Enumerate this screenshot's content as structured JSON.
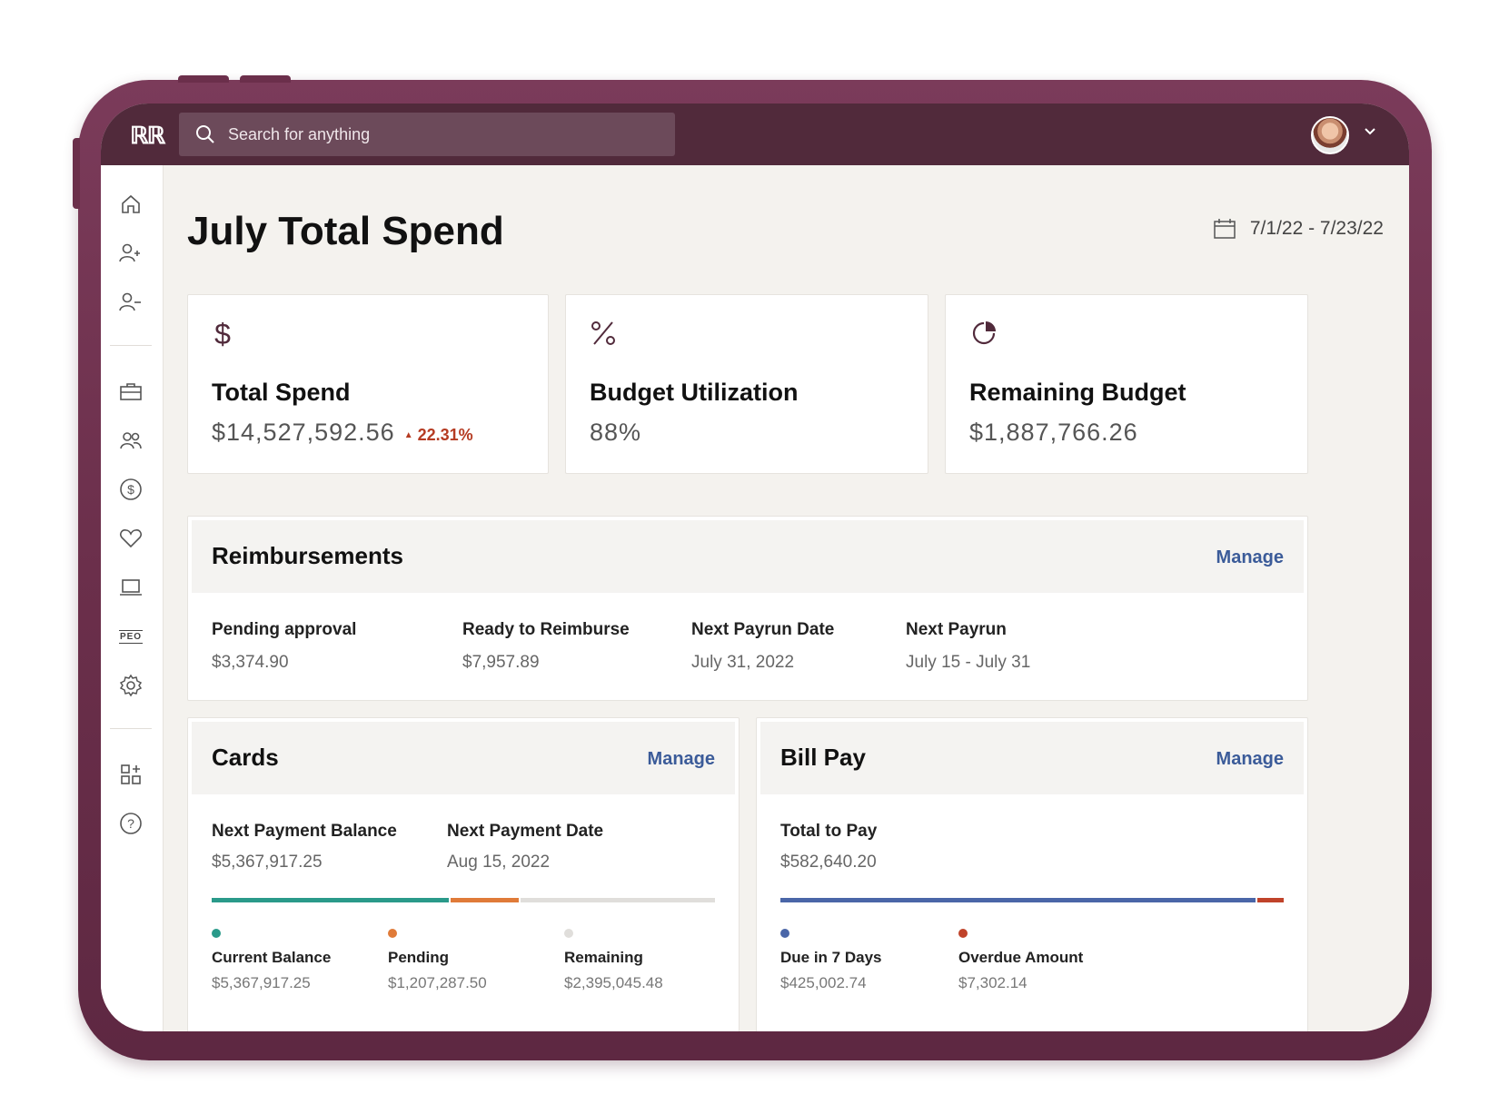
{
  "topbar": {
    "logo_text": "ℝℝ",
    "search_placeholder": "Search for anything",
    "avatar_alt": "User avatar"
  },
  "sidebar": {
    "icons": [
      "home-icon",
      "add-person-icon",
      "remove-person-icon",
      "briefcase-icon",
      "people-icon",
      "dollar-circle-icon",
      "heart-icon",
      "laptop-icon",
      "peo-icon",
      "settings-icon",
      "apps-add-icon",
      "help-icon"
    ],
    "peo_label": "PEO"
  },
  "header": {
    "title": "July Total Spend",
    "date_range": "7/1/22 - 7/23/22"
  },
  "stats": {
    "total_spend": {
      "label": "Total Spend",
      "value": "$14,527,592.56",
      "trend": "22.31%",
      "trend_arrow": "▲"
    },
    "budget_utilization": {
      "label": "Budget Utilization",
      "value": "88%"
    },
    "remaining_budget": {
      "label": "Remaining Budget",
      "value": "$1,887,766.26"
    }
  },
  "reimbursements": {
    "title": "Reimbursements",
    "manage": "Manage",
    "items": [
      {
        "label": "Pending approval",
        "value": "$3,374.90"
      },
      {
        "label": "Ready to Reimburse",
        "value": "$7,957.89"
      },
      {
        "label": "Next Payrun Date",
        "value": "July 31, 2022"
      },
      {
        "label": "Next Payrun",
        "value": "July 15 - July 31"
      }
    ]
  },
  "cards": {
    "title": "Cards",
    "manage": "Manage",
    "next_balance_label": "Next Payment Balance",
    "next_balance_value": "$5,367,917.25",
    "next_date_label": "Next Payment Date",
    "next_date_value": "Aug 15, 2022",
    "legend": [
      {
        "label": "Current Balance",
        "value": "$5,367,917.25",
        "color": "#2a9a8a",
        "share": 0.474
      },
      {
        "label": "Pending",
        "value": "$1,207,287.50",
        "color": "#e07b39",
        "share": 0.139
      },
      {
        "label": "Remaining",
        "value": "$2,395,045.48",
        "color": "#e0dedb",
        "share": 0.387
      }
    ]
  },
  "billpay": {
    "title": "Bill Pay",
    "manage": "Manage",
    "total_label": "Total to Pay",
    "total_value": "$582,640.20",
    "legend": [
      {
        "label": "Due in 7 Days",
        "value": "$425,002.74",
        "color": "#4a66a8",
        "share": 0.948
      },
      {
        "label": "Overdue Amount",
        "value": "$7,302.14",
        "color": "#c0432a",
        "share": 0.052
      }
    ]
  }
}
